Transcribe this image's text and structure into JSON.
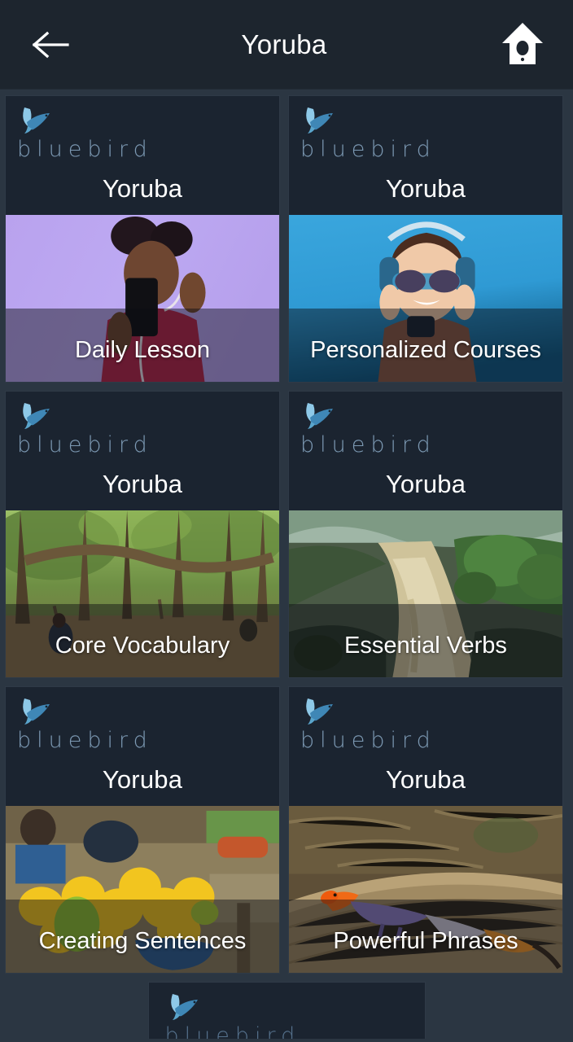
{
  "appbar": {
    "back_icon": "arrow-left-icon",
    "title": "Yoruba",
    "home_icon": "birdhouse-icon"
  },
  "brand": {
    "wordmark": "bluebird",
    "bird_icon": "bluebird-icon",
    "wordmark_color": "#7d9ab4",
    "bird_color": "#4f9ed0"
  },
  "theme": {
    "page_background": "#2b3642",
    "appbar_background": "#1d252e",
    "card_background": "#1b2430",
    "card_border": "#2f3a47",
    "text_primary": "#ffffff"
  },
  "cards": [
    {
      "language": "Yoruba",
      "label": "Daily Lesson",
      "photo": "woman-with-phone-purple-background"
    },
    {
      "language": "Yoruba",
      "label": "Personalized Courses",
      "photo": "woman-with-headphones-blue-background"
    },
    {
      "language": "Yoruba",
      "label": "Core Vocabulary",
      "photo": "banyan-tree-grove"
    },
    {
      "language": "Yoruba",
      "label": "Essential Verbs",
      "photo": "waterfall-in-green-hills"
    },
    {
      "language": "Yoruba",
      "label": "Creating Sentences",
      "photo": "mangoes-at-market-stall"
    },
    {
      "language": "Yoruba",
      "label": "Powerful Phrases",
      "photo": "agama-lizard-on-log"
    }
  ],
  "partial_card": {
    "wordmark": "bluebird"
  }
}
